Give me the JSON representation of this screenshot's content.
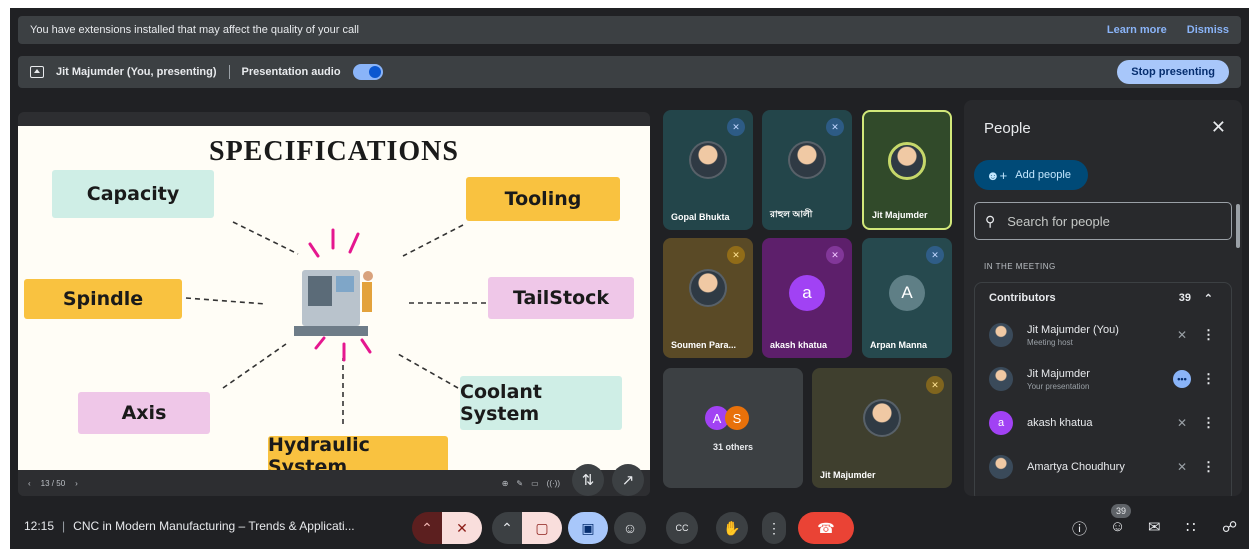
{
  "banner": {
    "message": "You have extensions installed that may affect the quality of your call",
    "learn_more": "Learn more",
    "dismiss": "Dismiss"
  },
  "presenting_bar": {
    "presenter": "Jit Majumder (You, presenting)",
    "audio_label": "Presentation audio",
    "audio_on": true,
    "stop_label": "Stop presenting"
  },
  "slide": {
    "title": "SPECIFICATIONS",
    "boxes": {
      "capacity": "Capacity",
      "tooling": "Tooling",
      "spindle": "Spindle",
      "tailstock": "TailStock",
      "axis": "Axis",
      "coolant": "Coolant System",
      "hydraulic": "Hydraulic System"
    },
    "page_indicator": "13 / 50",
    "progress": 0.26
  },
  "tiles": [
    {
      "name": "Gopal Bhukta",
      "type": "photo",
      "muted": true
    },
    {
      "name": "রাহুল আলী",
      "type": "photo",
      "muted": true
    },
    {
      "name": "Jit Majumder",
      "type": "photo",
      "muted": false,
      "active": true
    },
    {
      "name": "Soumen Para...",
      "type": "photo",
      "muted": true
    },
    {
      "name": "akash khatua",
      "type": "letter",
      "letter": "a",
      "muted": true
    },
    {
      "name": "Arpan Manna",
      "type": "letter",
      "letter": "A",
      "muted": true
    },
    {
      "name": "31 others",
      "letters": [
        "A",
        "S"
      ]
    },
    {
      "name": "Jit Majumder",
      "type": "photo",
      "muted": true
    }
  ],
  "people_panel": {
    "title": "People",
    "add_people": "Add people",
    "search_placeholder": "Search for people",
    "section": "IN THE MEETING",
    "contributors_label": "Contributors",
    "contributors_count": "39",
    "people": [
      {
        "name": "Jit Majumder (You)",
        "sub": "Meeting host",
        "status": "muted"
      },
      {
        "name": "Jit Majumder",
        "sub": "Your presentation",
        "status": "speaking"
      },
      {
        "name": "akash khatua",
        "sub": "",
        "status": "muted",
        "letter": "a"
      },
      {
        "name": "Amartya Choudhury",
        "sub": "",
        "status": "muted"
      }
    ]
  },
  "bottom_bar": {
    "time": "12:15",
    "meeting_title": "CNC in Modern Manufacturing – Trends & Applicati...",
    "people_count": "39"
  },
  "colors": {
    "background": "#202124",
    "accent_blue": "#8ab4f8",
    "end_call_red": "#ea4335",
    "muted_red": "#f9dedc"
  }
}
